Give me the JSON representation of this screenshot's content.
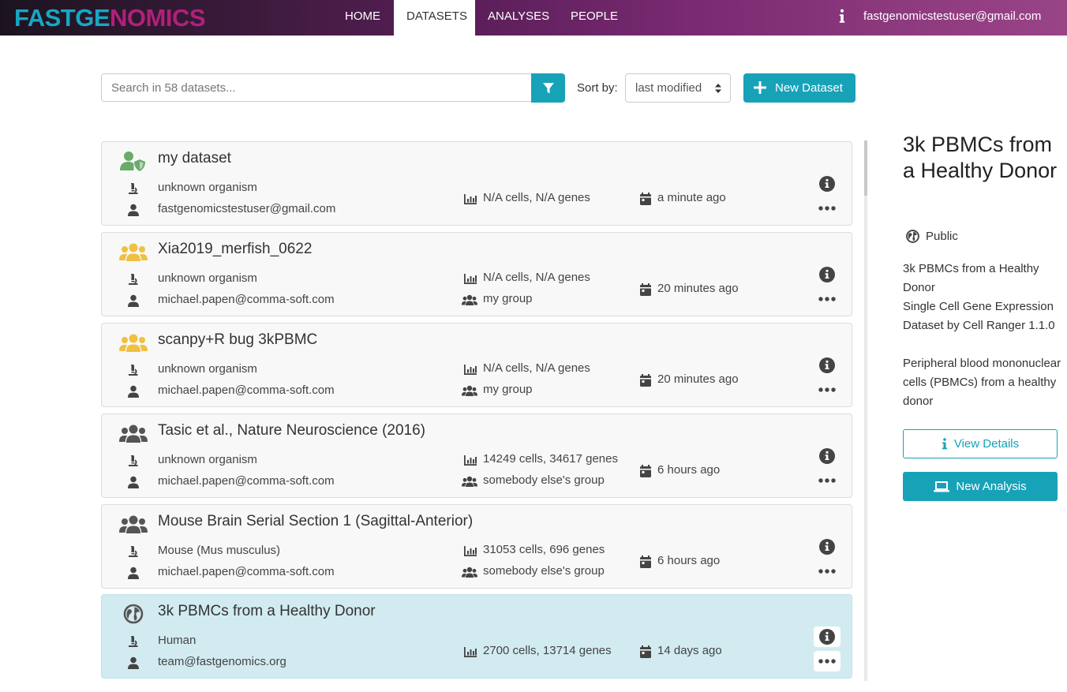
{
  "header": {
    "logo_part1": "FASTGE",
    "logo_part2": "NOMICS",
    "nav": [
      "HOME",
      "DATASETS",
      "ANALYSES",
      "PEOPLE"
    ],
    "active_nav": "DATASETS",
    "user_email": "fastgenomicstestuser@gmail.com"
  },
  "toolbar": {
    "search_placeholder": "Search in 58 datasets...",
    "sort_label": "Sort by:",
    "sort_value": "last modified",
    "new_dataset_label": "New Dataset"
  },
  "datasets": [
    {
      "title": "my dataset",
      "type_icon": "user-shield-icon",
      "type_color": "#6aaa6a",
      "organism": "unknown organism",
      "owner": "fastgenomicstestuser@gmail.com",
      "stats": "N/A cells, N/A genes",
      "group": "",
      "modified": "a minute ago"
    },
    {
      "title": "Xia2019_merfish_0622",
      "type_icon": "users-icon",
      "type_color": "#f0c040",
      "organism": "unknown organism",
      "owner": "michael.papen@comma-soft.com",
      "stats": "N/A cells, N/A genes",
      "group": "my group",
      "modified": "20 minutes ago"
    },
    {
      "title": "scanpy+R bug 3kPBMC",
      "type_icon": "users-icon",
      "type_color": "#f0c040",
      "organism": "unknown organism",
      "owner": "michael.papen@comma-soft.com",
      "stats": "N/A cells, N/A genes",
      "group": "my group",
      "modified": "20 minutes ago"
    },
    {
      "title": "Tasic et al., Nature Neuroscience (2016)",
      "type_icon": "users-icon",
      "type_color": "#555555",
      "organism": "unknown organism",
      "owner": "michael.papen@comma-soft.com",
      "stats": "14249 cells, 34617 genes",
      "group": "somebody else's group",
      "modified": "6 hours ago"
    },
    {
      "title": "Mouse Brain Serial Section 1 (Sagittal-Anterior)",
      "type_icon": "users-icon",
      "type_color": "#555555",
      "organism": "Mouse (Mus musculus)",
      "owner": "michael.papen@comma-soft.com",
      "stats": "31053 cells, 696 genes",
      "group": "somebody else's group",
      "modified": "6 hours ago"
    },
    {
      "title": "3k PBMCs from a Healthy Donor",
      "type_icon": "globe-icon",
      "type_color": "#555555",
      "organism": "Human",
      "owner": "team@fastgenomics.org",
      "stats": "2700 cells, 13714 genes",
      "group": "",
      "modified": "14 days ago",
      "selected": true
    }
  ],
  "details": {
    "title": "3k PBMCs from a Healthy Donor",
    "visibility": "Public",
    "description": "3k PBMCs from a Healthy Donor\nSingle Cell Gene Expression Dataset by Cell Ranger 1.1.0\n\nPeripheral blood mononuclear cells (PBMCs) from a healthy donor",
    "view_details_label": "View Details",
    "new_analysis_label": "New Analysis"
  },
  "colors": {
    "accent": "#17a2b8",
    "selected_row": "#d2ebf1"
  }
}
